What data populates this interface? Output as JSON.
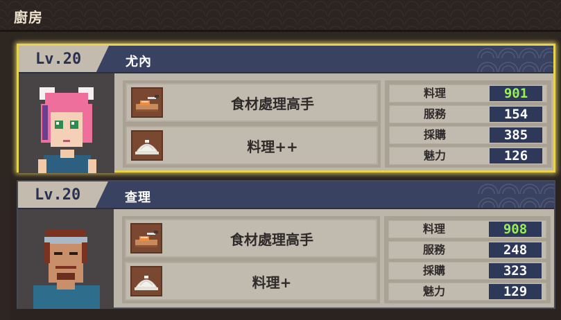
{
  "screen": {
    "title": "廚房"
  },
  "chefs": [
    {
      "level": "Lv.20",
      "name": "尤內",
      "selected": true,
      "portrait_icon": "pink-haired-chef-portrait",
      "skills": [
        {
          "icon": "knife-cutting-board-icon",
          "label": "食材處理高手"
        },
        {
          "icon": "cloche-dish-icon",
          "label": "料理++"
        }
      ],
      "stats": [
        {
          "name": "料理",
          "value": "901",
          "highlight": true
        },
        {
          "name": "服務",
          "value": "154",
          "highlight": false
        },
        {
          "name": "採購",
          "value": "385",
          "highlight": false
        },
        {
          "name": "魅力",
          "value": "126",
          "highlight": false
        }
      ]
    },
    {
      "level": "Lv.20",
      "name": "查理",
      "selected": false,
      "portrait_icon": "headband-chef-portrait",
      "skills": [
        {
          "icon": "knife-cutting-board-icon",
          "label": "食材處理高手"
        },
        {
          "icon": "cloche-dish-icon",
          "label": "料理+"
        }
      ],
      "stats": [
        {
          "name": "料理",
          "value": "908",
          "highlight": true
        },
        {
          "name": "服務",
          "value": "248",
          "highlight": false
        },
        {
          "name": "採購",
          "value": "323",
          "highlight": false
        },
        {
          "name": "魅力",
          "value": "129",
          "highlight": false
        }
      ]
    }
  ],
  "colors": {
    "highlight_value": "#98ef5e",
    "selection_border": "#e6d34f",
    "header_navy": "#3a4262"
  }
}
